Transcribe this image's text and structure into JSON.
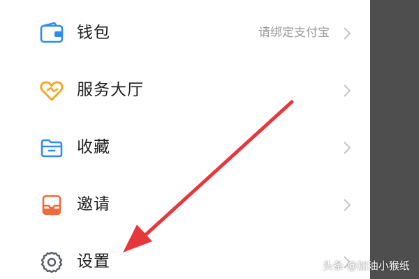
{
  "menu": {
    "items": [
      {
        "label": "钱包",
        "value": "请绑定支付宝",
        "icon": "wallet-icon",
        "icon_color": "#2f8cf0"
      },
      {
        "label": "服务大厅",
        "value": "",
        "icon": "heart-service-icon",
        "icon_color": "#f6a623"
      },
      {
        "label": "收藏",
        "value": "",
        "icon": "folder-icon",
        "icon_color": "#2f8cf0"
      },
      {
        "label": "邀请",
        "value": "",
        "icon": "invite-icon",
        "icon_color": "#f06a3c"
      },
      {
        "label": "设置",
        "value": "",
        "icon": "gear-icon",
        "icon_color": "#555c66"
      }
    ]
  },
  "annotation": {
    "arrow_color": "#e8363d"
  },
  "watermark": {
    "text": "头条 @加油小猴纸"
  }
}
